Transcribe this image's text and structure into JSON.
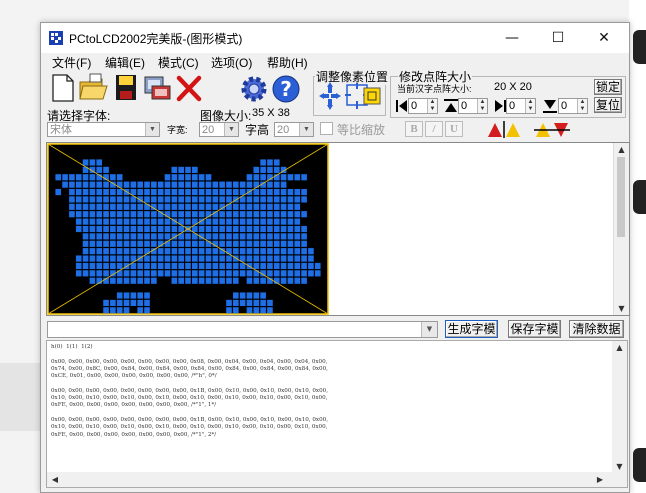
{
  "window": {
    "title": "PCtoLCD2002完美版-(图形模式)",
    "controls": {
      "minimize": "—",
      "maximize": "☐",
      "close": "✕"
    }
  },
  "menu": [
    "文件(F)",
    "编辑(E)",
    "模式(C)",
    "选项(O)",
    "帮助(H)"
  ],
  "toolbar": {
    "icons": [
      "new-icon",
      "open-icon",
      "save-icon",
      "generate-icon",
      "delete-icon",
      "settings-gear-icon",
      "help-icon"
    ]
  },
  "font_section": {
    "label": "请选择字体:",
    "font_value": "宋体",
    "width_label": "字宽:",
    "width_value": "20",
    "height_label": "字高",
    "height_value": "20",
    "proportional_label": "等比缩放",
    "format_buttons": [
      "B",
      "/",
      "U"
    ]
  },
  "image_size": {
    "label": "图像大小:",
    "value": "35 X 38"
  },
  "pixel_group": {
    "title": "调整像素位置"
  },
  "matrix_group": {
    "title": "修改点阵大小",
    "current_label": "当前汉字点阵大小:",
    "current_value": "20  X  20",
    "lock_label": "锁定",
    "reset_label": "复位",
    "spin_values": [
      "0",
      "0",
      "0",
      "0"
    ]
  },
  "canvas": {
    "pixel_color": "#1e6fe6",
    "background": "#000000",
    "rows": [
      "00000000000000000000000000000000000000000",
      "00000000000000000000000000000000000000000",
      "00000111000000000000000000000001110000000",
      "00000111100000000011110000000011111000000",
      "01111111111000000111111100000111111111000",
      "00111111111111111111111111111111111000000",
      "01011111111111111111111111111111111111000",
      "00011111111111111111111111111111111111000",
      "00011111111111111111111111111111111110000",
      "00011111111111111111111111111111111111000",
      "00001111111111111111111111111111111110000",
      "00001111111111111111111111111111111111000",
      "00000111111111111111111111111111111111000",
      "00000111111111111111111111111111111111000",
      "00000111111111111111111111111111111111100",
      "00001111111111111111111111111111111111100",
      "00001111111111111111111111111111111111110",
      "00001111111111111111111111111111111111110",
      "00000011111111110011111111110111111111000",
      "00000000000000000000000000000000000000000",
      "00000000001111100000000000011111000000000",
      "00000000111111100000000000111111100000000",
      "00000000111101100000000000110111100000000"
    ]
  },
  "bottom_bar": {
    "generate_label": "生成字模",
    "save_label": "保存字模",
    "clear_label": "清除数据"
  },
  "output_lines": [
    "h(0)  1(1)  1(2)",
    "",
    "0x00, 0x00, 0x00, 0x00, 0x00, 0x00, 0x00, 0x00, 0x08, 0x00, 0x04, 0x00, 0x04, 0x00, 0x04, 0x00,",
    "0x74, 0x00, 0x8C, 0x00, 0x84, 0x00, 0x84, 0x00, 0x84, 0x00, 0x84, 0x00, 0x84, 0x00, 0x84, 0x00,",
    "0xCE, 0x01, 0x00, 0x00, 0x00, 0x00, 0x00, 0x00, /*\"h\", 0*/",
    "",
    "0x00, 0x00, 0x00, 0x00, 0x00, 0x00, 0x00, 0x00, 0x1B, 0x00, 0x10, 0x00, 0x10, 0x00, 0x10, 0x00,",
    "0x10, 0x00, 0x10, 0x00, 0x10, 0x00, 0x10, 0x00, 0x10, 0x00, 0x10, 0x00, 0x10, 0x00, 0x10, 0x00,",
    "0xFE, 0x00, 0x00, 0x00, 0x00, 0x00, 0x00, 0x00, /*\"1\", 1*/",
    "",
    "0x00, 0x00, 0x00, 0x00, 0x00, 0x00, 0x00, 0x00, 0x1B, 0x00, 0x10, 0x00, 0x10, 0x00, 0x10, 0x00,",
    "0x10, 0x00, 0x10, 0x00, 0x10, 0x00, 0x10, 0x00, 0x10, 0x00, 0x10, 0x00, 0x10, 0x00, 0x10, 0x00,",
    "0xFE, 0x00, 0x00, 0x00, 0x00, 0x00, 0x00, 0x00, /*\"1\", 2*/"
  ]
}
